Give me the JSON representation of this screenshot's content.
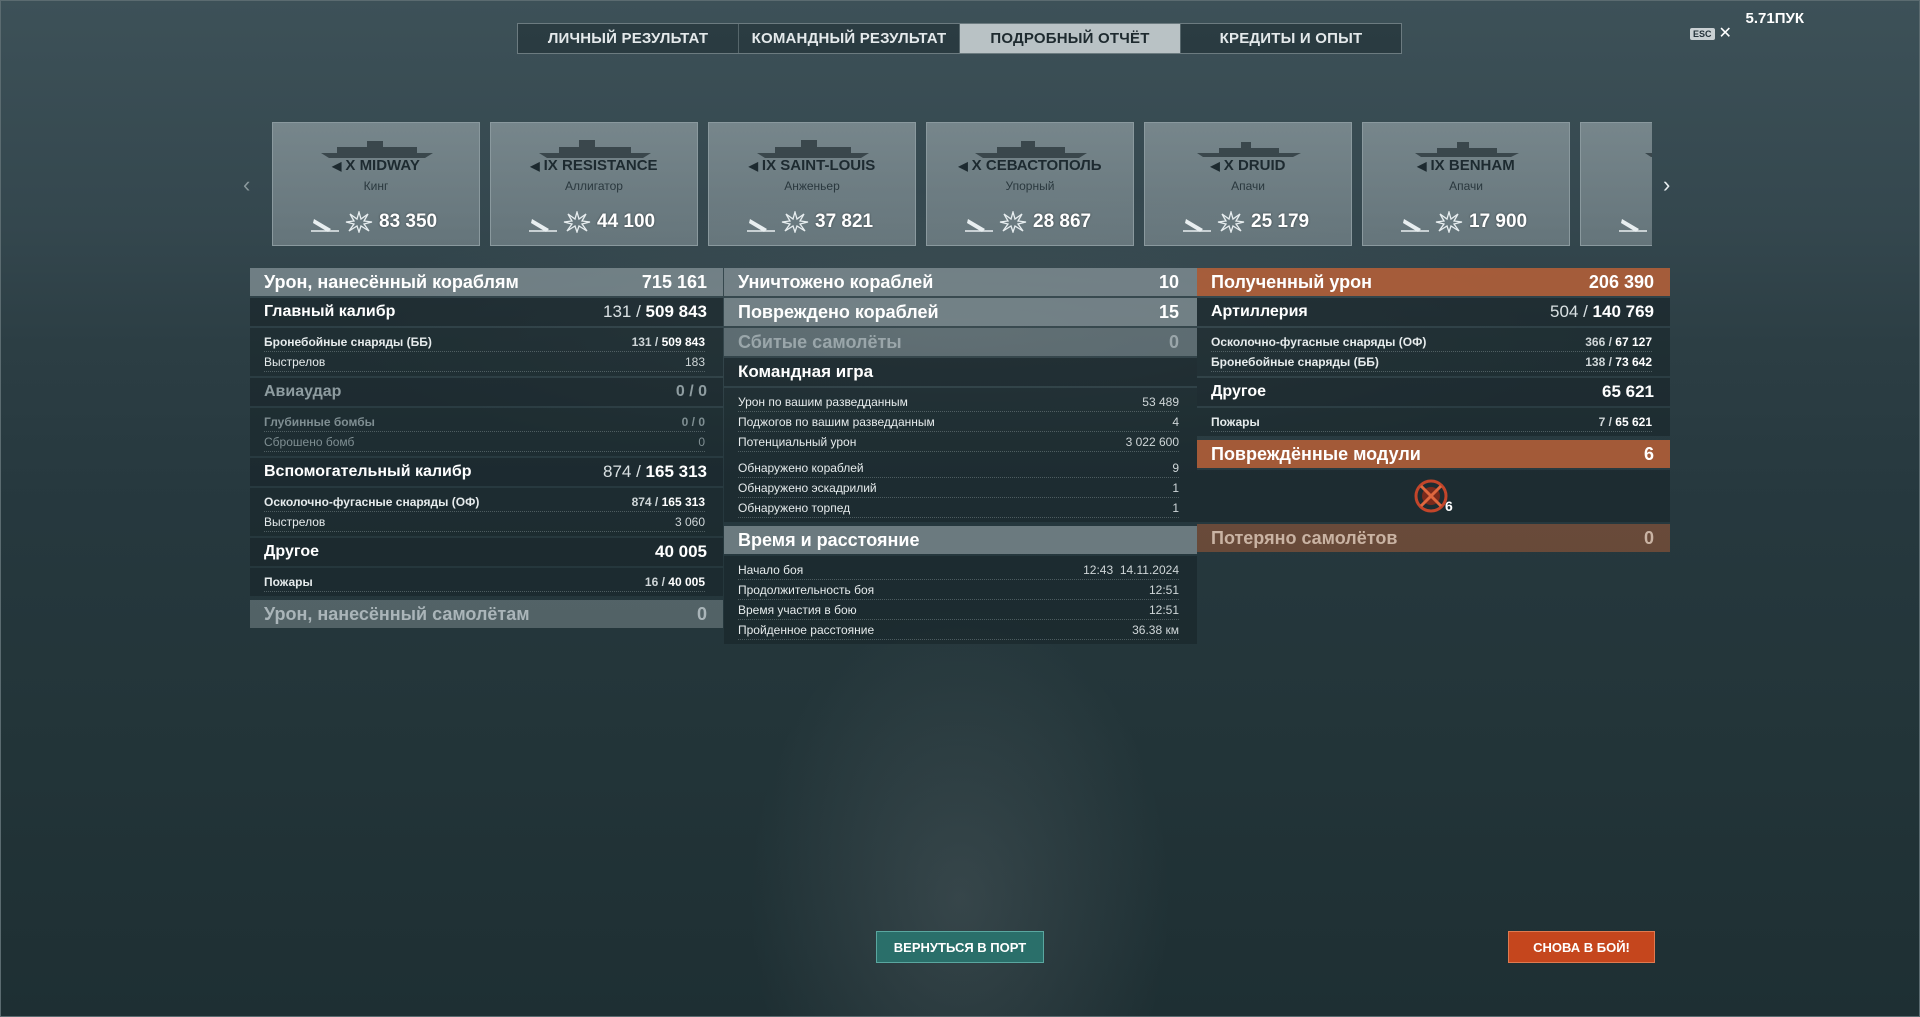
{
  "header": {
    "tabs": [
      {
        "label": "ЛИЧНЫЙ РЕЗУЛЬТАТ",
        "active": false
      },
      {
        "label": "КОМАНДНЫЙ РЕЗУЛЬТАТ",
        "active": false
      },
      {
        "label": "ПОДРОБНЫЙ ОТЧЁТ",
        "active": true
      },
      {
        "label": "КРЕДИТЫ И ОПЫТ",
        "active": false
      }
    ],
    "top_right_text": "5.71ПУК",
    "esc_label": "ESC",
    "close_glyph": "✕"
  },
  "ships": [
    {
      "tier_class": "X",
      "name": "MIDWAY",
      "player": "Кинг",
      "damage": "83 350",
      "class_icon": "carrier-icon"
    },
    {
      "tier_class": "IX",
      "name": "RESISTANCE",
      "player": "Аллигатор",
      "damage": "44 100",
      "class_icon": "battleship-icon"
    },
    {
      "tier_class": "IX",
      "name": "SAINT-LOUIS",
      "player": "Анженьер",
      "damage": "37 821",
      "class_icon": "battleship-icon"
    },
    {
      "tier_class": "X",
      "name": "СЕВАСТОПОЛЬ",
      "player": "Упорный",
      "damage": "28 867",
      "class_icon": "cruiser-icon"
    },
    {
      "tier_class": "X",
      "name": "DRUID",
      "player": "Апачи",
      "damage": "25 179",
      "class_icon": "destroyer-icon"
    },
    {
      "tier_class": "IX",
      "name": "BENHAM",
      "player": "Апачи",
      "damage": "17 900",
      "class_icon": "destroyer-icon"
    }
  ],
  "nav": {
    "prev": "‹",
    "next": "›"
  },
  "col1": {
    "ship_damage": {
      "label": "Урон, нанесённый кораблям",
      "value": "715 161"
    },
    "main_caliber": {
      "label": "Главный калибр",
      "hits": "131",
      "dmg": "509 843"
    },
    "ap_shells": {
      "label": "Бронебойные снаряды (ББ)",
      "hits": "131",
      "dmg": "509 843"
    },
    "mc_shots": {
      "label": "Выстрелов",
      "value": "183"
    },
    "airstrike": {
      "label": "Авиаудар",
      "value": "0 / 0"
    },
    "depth_charges": {
      "label": "Глубинные бомбы",
      "value": "0 / 0"
    },
    "bombs_dropped": {
      "label": "Сброшено бомб",
      "value": "0"
    },
    "secondary": {
      "label": "Вспомогательный калибр",
      "hits": "874",
      "dmg": "165 313"
    },
    "he_shells": {
      "label": "Осколочно-фугасные снаряды (ОФ)",
      "hits": "874",
      "dmg": "165 313"
    },
    "sec_shots": {
      "label": "Выстрелов",
      "value": "3 060"
    },
    "other": {
      "label": "Другое",
      "value": "40 005"
    },
    "fires": {
      "label": "Пожары",
      "hits": "16",
      "dmg": "40 005"
    },
    "plane_damage": {
      "label": "Урон, нанесённый самолётам",
      "value": "0"
    }
  },
  "col2": {
    "destroyed": {
      "label": "Уничтожено кораблей",
      "value": "10"
    },
    "damaged": {
      "label": "Повреждено кораблей",
      "value": "15"
    },
    "planes_shot": {
      "label": "Сбитые самолёты",
      "value": "0"
    },
    "team_title": "Командная игра",
    "scout_damage": {
      "label": "Урон по вашим разведданным",
      "value": "53 489"
    },
    "scout_fires": {
      "label": "Поджогов по вашим разведданным",
      "value": "4"
    },
    "potential": {
      "label": "Потенциальный урон",
      "value": "3 022 600"
    },
    "spotted_ships": {
      "label": "Обнаружено кораблей",
      "value": "9"
    },
    "spotted_squads": {
      "label": "Обнаружено эскадрилий",
      "value": "1"
    },
    "spotted_torps": {
      "label": "Обнаружено торпед",
      "value": "1"
    },
    "time_title": "Время и расстояние",
    "battle_start": {
      "label": "Начало боя",
      "time": "12:43",
      "date": "14.11.2024"
    },
    "duration": {
      "label": "Продолжительность боя",
      "value": "12:51"
    },
    "participation": {
      "label": "Время участия в бою",
      "value": "12:51"
    },
    "distance": {
      "label": "Пройденное расстояние",
      "value": "36.38 км"
    }
  },
  "col3": {
    "received": {
      "label": "Полученный урон",
      "value": "206 390"
    },
    "artillery": {
      "label": "Артиллерия",
      "hits": "504",
      "dmg": "140 769"
    },
    "he_recv": {
      "label": "Осколочно-фугасные снаряды (ОФ)",
      "hits": "366",
      "dmg": "67 127"
    },
    "ap_recv": {
      "label": "Бронебойные снаряды (ББ)",
      "hits": "138",
      "dmg": "73 642"
    },
    "other": {
      "label": "Другое",
      "value": "65 621"
    },
    "fires": {
      "label": "Пожары",
      "hits": "7",
      "dmg": "65 621"
    },
    "modules": {
      "label": "Повреждённые модули",
      "value": "6",
      "icon_count": "6"
    },
    "planes_lost": {
      "label": "Потеряно самолётов",
      "value": "0"
    }
  },
  "buttons": {
    "port": "ВЕРНУТЬСЯ В ПОРТ",
    "battle": "СНОВА В БОЙ!"
  },
  "colors": {
    "accent_orange": "#c5461d",
    "active_tab": "#b9c2c5",
    "port_button": "#2a6f6a"
  }
}
